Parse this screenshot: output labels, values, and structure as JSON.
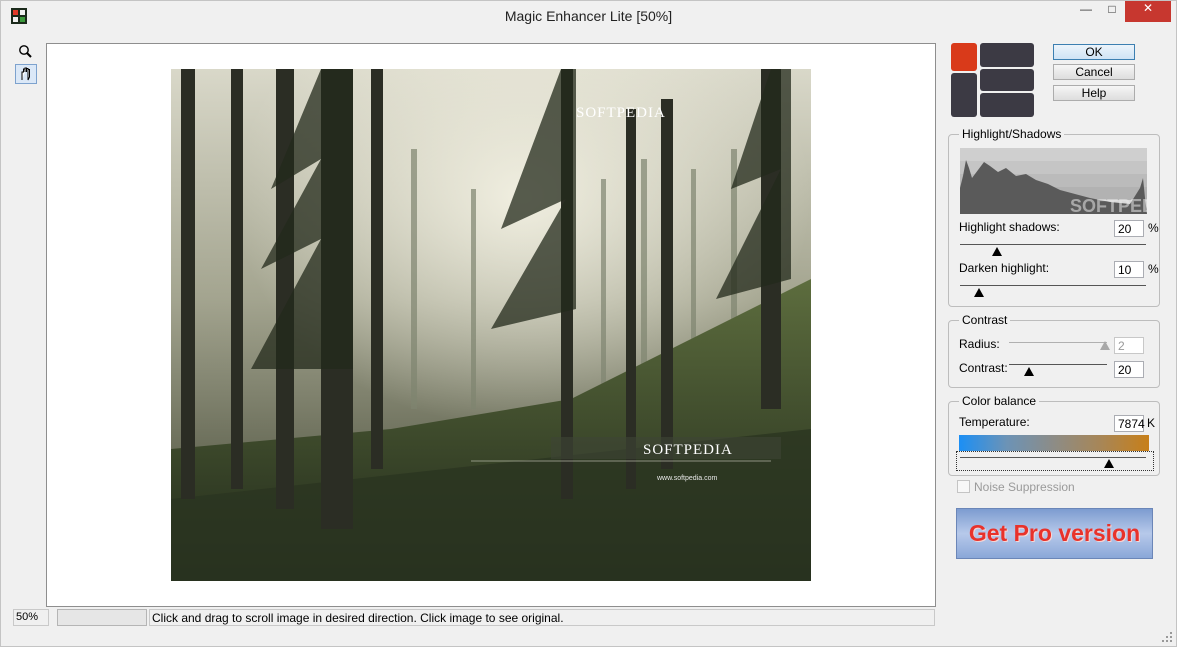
{
  "window": {
    "title": "Magic Enhancer Lite [50%]",
    "controls": {
      "minimize": "—",
      "maximize": "□",
      "close": "✕"
    }
  },
  "tools": [
    {
      "name": "zoom-tool",
      "icon": "magnifier-icon"
    },
    {
      "name": "hand-tool",
      "icon": "hand-icon",
      "active": true
    }
  ],
  "image": {
    "watermark_top": "SOFTPEDIA",
    "watermark_mid": "SOFTPEDIA",
    "watermark_url": "www.softpedia.com"
  },
  "buttons": {
    "ok": "OK",
    "cancel": "Cancel",
    "help": "Help"
  },
  "highlight_shadows": {
    "legend": "Highlight/Shadows",
    "histogram_watermark": "SOFTPEDIA",
    "highlight_label": "Highlight shadows:",
    "highlight_value": "20",
    "highlight_unit": "%",
    "highlight_level": 0.2,
    "darken_label": "Darken highlight:",
    "darken_value": "10",
    "darken_unit": "%",
    "darken_level": 0.1
  },
  "contrast": {
    "legend": "Contrast",
    "radius_label": "Radius:",
    "radius_value": "2",
    "radius_enabled": false,
    "contrast_label": "Contrast:",
    "contrast_value": "20",
    "contrast_level": 0.2
  },
  "color_balance": {
    "legend": "Color balance",
    "temperature_label": "Temperature:",
    "temperature_value": "7874",
    "temperature_unit": "K",
    "temperature_level": 0.8,
    "gradient_colors": [
      "#1b8ff5",
      "#8d8c86",
      "#c77f19"
    ]
  },
  "noise_suppression": {
    "label": "Noise Suppression",
    "checked": false,
    "enabled": false
  },
  "promo": {
    "label": "Get Pro version"
  },
  "status": {
    "zoom": "50%",
    "message": "Click and drag to scroll image in desired direction. Click image to see original."
  },
  "colors": {
    "close_button": "#c7372f",
    "promo_text": "#e8322b",
    "logo_red": "#d93a1a",
    "logo_dark": "#3c3a44"
  }
}
